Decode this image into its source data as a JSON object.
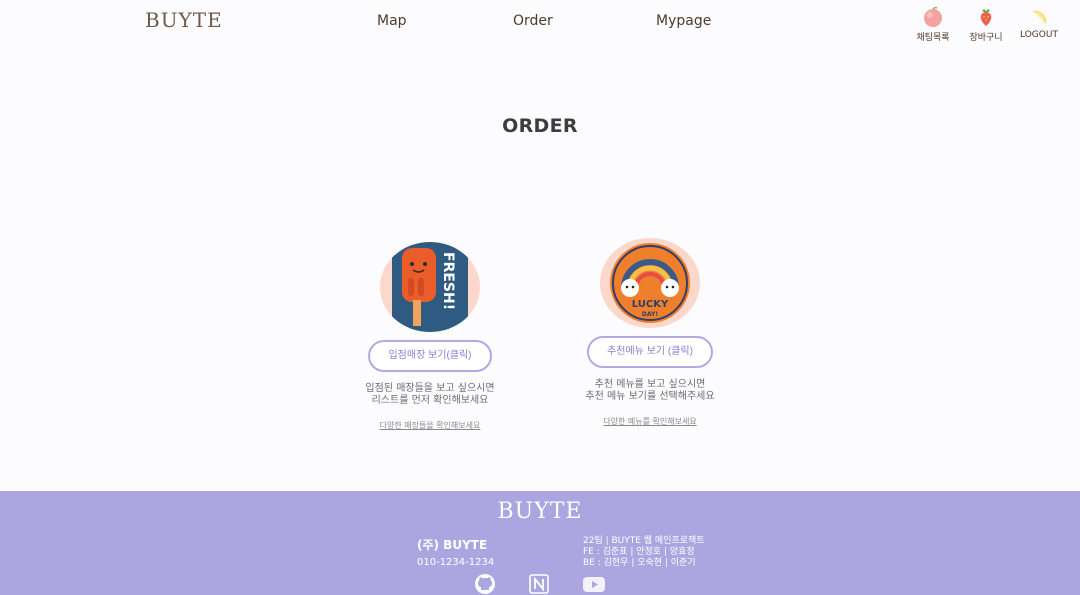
{
  "header": {
    "logo": "BUYTE",
    "nav": {
      "map": "Map",
      "order": "Order",
      "mypage": "Mypage"
    },
    "utilities": {
      "wishlist": {
        "label": "채팅목록",
        "icon": "peach-icon"
      },
      "cart": {
        "label": "장바구니",
        "icon": "strawberry-icon"
      },
      "logout": {
        "label": "LOGOUT",
        "icon": "lemon-icon"
      }
    }
  },
  "main": {
    "title": "ORDER",
    "cards": {
      "stores": {
        "button": "입점매장 보기(클릭)",
        "desc_line1": "입점된 매장들을 보고 싶으시면",
        "desc_line2": "리스트를 먼저 확인해보세요",
        "link": "다양한 매장들을 확인해보세요",
        "image_icon": "popsicle-fresh-sticker",
        "image_text": "FRESH!"
      },
      "recommend": {
        "button": "추천메뉴 보기 (클릭)",
        "desc_line1": "추천 메뉴를 보고 싶으시면",
        "desc_line2": "추천 메뉴 보기를 선택해주세요",
        "link": "다양한 메뉴를 확인해보세요",
        "image_icon": "rainbow-lucky-sticker",
        "image_text_1": "LUCKY",
        "image_text_2": "DAY!"
      }
    }
  },
  "footer": {
    "logo": "BUYTE",
    "company_name": "(주) BUYTE",
    "phone": "010-1234-1234",
    "team_line1": "22팀 | BUYTE 웹 메인프로젝트",
    "team_line2": "FE : 김준표 | 안정호 | 양효정",
    "team_line3": "BE : 김현우 | 오숙현 | 이준기",
    "social": [
      "github-icon",
      "notion-icon",
      "youtube-icon"
    ]
  },
  "colors": {
    "accent": "#aba6e0",
    "button_border": "#b3a9e4",
    "circle_bg": "#fbd7cc",
    "nav_text": "#4e3a2a"
  }
}
